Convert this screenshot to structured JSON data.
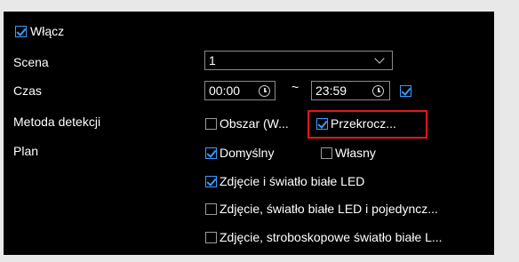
{
  "enable": {
    "label": "Włącz",
    "checked": true
  },
  "scene": {
    "label": "Scena",
    "value": "1"
  },
  "time": {
    "label": "Czas",
    "start": "00:00",
    "separator": "~",
    "end": "23:59",
    "checked": true
  },
  "detection": {
    "label": "Metoda detekcji",
    "options": [
      {
        "label": "Obszar (W...",
        "checked": false
      },
      {
        "label": "Przekrocz...",
        "checked": true
      }
    ]
  },
  "plan": {
    "label": "Plan",
    "options": [
      {
        "label": "Domyślny",
        "checked": true
      },
      {
        "label": "Własny",
        "checked": false
      }
    ]
  },
  "actions": [
    {
      "label": "Zdjęcie i światło białe LED",
      "checked": true
    },
    {
      "label": "Zdjęcie, światło białe LED i pojedyncz...",
      "checked": false
    },
    {
      "label": "Zdjęcie, stroboskopowe światło białe L...",
      "checked": false
    }
  ],
  "colors": {
    "accent": "#3b9cff",
    "highlight": "#e8141b",
    "background": "#000000"
  }
}
